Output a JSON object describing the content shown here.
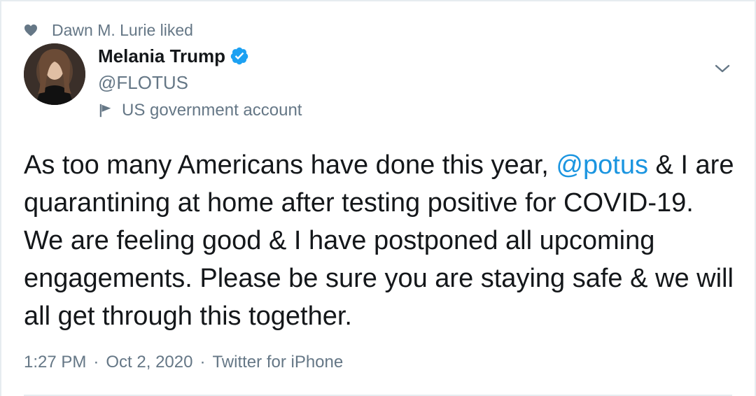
{
  "social_context": {
    "text": "Dawn M. Lurie liked",
    "icon": "heart-icon"
  },
  "author": {
    "name": "Melania Trump",
    "handle": "@FLOTUS",
    "verified_icon": "verified-badge-icon",
    "label": "US government account",
    "label_icon": "flag-icon"
  },
  "tweet": {
    "text_part1": "As too many Americans have done this year, ",
    "mention": "@potus",
    "text_part2": " & I are quarantining at home after testing positive for COVID-19. We are feeling good & I have postponed all upcoming engagements. Please be sure you are staying safe & we will all get through this together."
  },
  "meta": {
    "time": "1:27 PM",
    "separator": "·",
    "date": "Oct 2, 2020",
    "source": "Twitter for iPhone"
  },
  "colors": {
    "link": "#1b95e0",
    "secondary_text": "#657786",
    "primary_text": "#14171a",
    "verified": "#1da1f2"
  }
}
